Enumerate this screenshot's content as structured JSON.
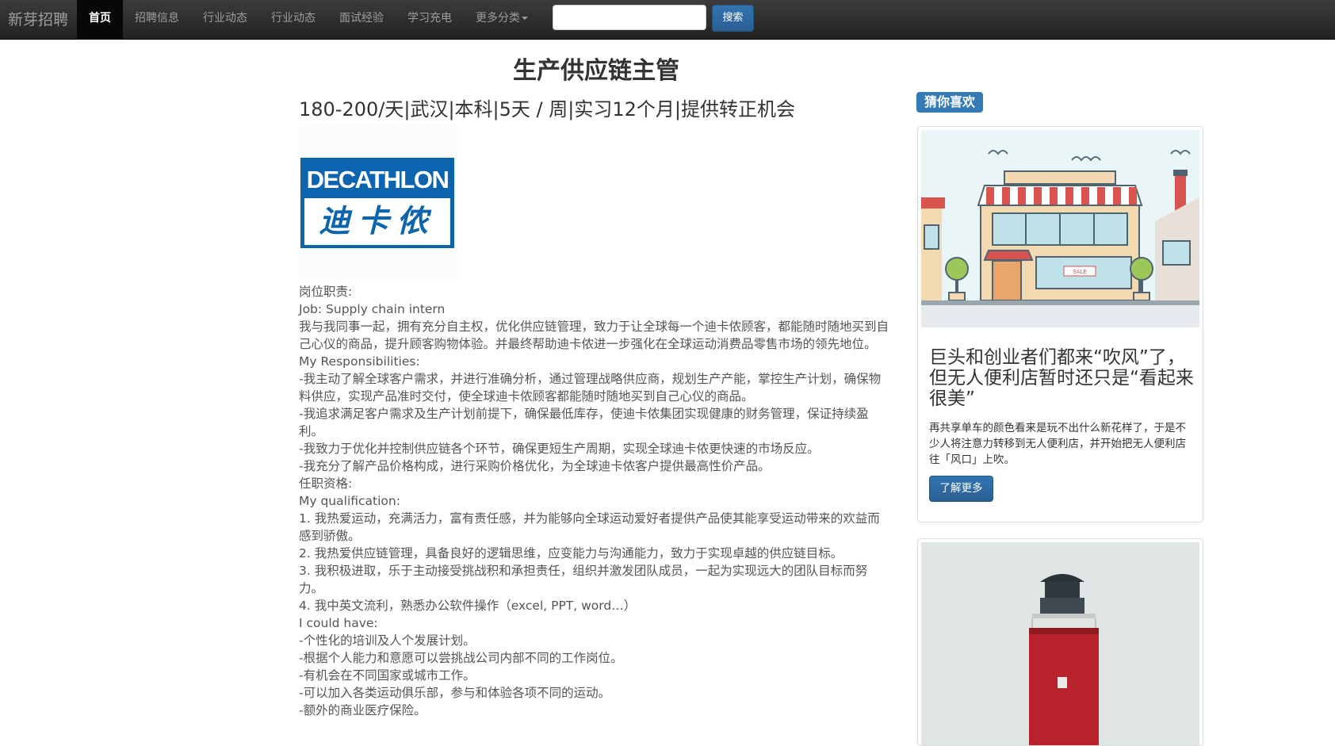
{
  "nav": {
    "brand": "新芽招聘",
    "items": [
      {
        "label": "首页",
        "active": true
      },
      {
        "label": "招聘信息"
      },
      {
        "label": "行业动态"
      },
      {
        "label": "行业动态"
      },
      {
        "label": "面试经验"
      },
      {
        "label": "学习充电"
      },
      {
        "label": "更多分类"
      }
    ],
    "search_value": "",
    "search_button": "搜索"
  },
  "job": {
    "title": "生产供应链主管",
    "summary": "180-200/天|武汉|本科|5天 / 周|实习12个月|提供转正机会",
    "logo_text_en": "DECATHLON",
    "logo_text_cn": "迪卡侬",
    "lines": [
      "岗位职责:",
      "Job: Supply chain intern",
      "我与我同事一起，拥有充分自主权，优化供应链管理，致力于让全球每一个迪卡侬顾客，都能随时随地买到自己心仪的商品，提升顾客购物体验。并最终帮助迪卡侬进一步强化在全球运动消费品零售市场的领先地位。",
      "My Responsibilities:",
      "-我主动了解全球客户需求，并进行准确分析，通过管理战略供应商，规划生产产能，掌控生产计划，确保物料供应，实现产品准时交付，使全球迪卡侬顾客都能随时随地买到自己心仪的商品。",
      "-我追求满足客户需求及生产计划前提下，确保最低库存，使迪卡侬集团实现健康的财务管理，保证持续盈利。",
      "-我致力于优化并控制供应链各个环节，确保更短生产周期，实现全球迪卡侬更快速的市场反应。",
      "-我充分了解产品价格构成，进行采购价格优化，为全球迪卡侬客户提供最高性价产品。",
      "任职资格:",
      "My qualification:",
      "1. 我热爱运动，充满活力，富有责任感，并为能够向全球运动爱好者提供产品使其能享受运动带来的欢益而感到骄傲。",
      "2. 我热爱供应链管理，具备良好的逻辑思维，应变能力与沟通能力，致力于实现卓越的供应链目标。",
      "3. 我积极进取，乐于主动接受挑战积和承担责任，组织并激发团队成员，一起为实现远大的团队目标而努力。",
      "4. 我中英文流利，熟悉办公软件操作（excel, PPT, word…）",
      "I could have:",
      "-个性化的培训及人个发展计划。",
      "-根据个人能力和意愿可以尝挑战公司内部不同的工作岗位。",
      "-有机会在不同国家或城市工作。",
      "-可以加入各类运动俱乐部，参与和体验各项不同的运动。",
      "-额外的商业医疗保险。"
    ]
  },
  "sidebar": {
    "badge": "猜你喜欢",
    "card1": {
      "title": "巨头和创业者们都来“吹风”了，但无人便利店暂时还只是“看起来很美”",
      "text": "再共享单车的颜色看来是玩不出什么新花样了，于是不少人将注意力转移到无人便利店，并开始把无人便利店往「风口」上吹。",
      "button": "了解更多",
      "sign": "SALE"
    }
  }
}
